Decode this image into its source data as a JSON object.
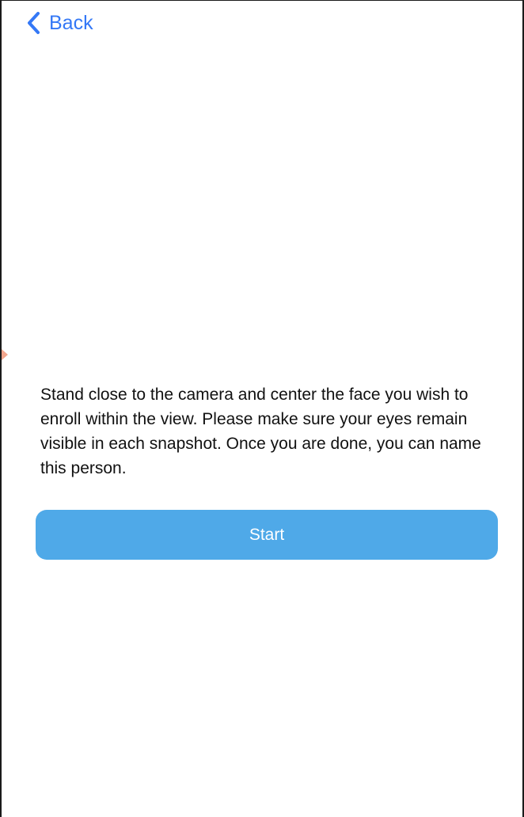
{
  "nav": {
    "back_label": "Back",
    "back_icon": "chevron-left-icon",
    "accent_color": "#3478f6"
  },
  "content": {
    "instructions": "Stand close to the camera and center the face you wish to enroll within the view. Please make sure your eyes remain visible in each snapshot. Once you are done, you can name this person."
  },
  "actions": {
    "start_label": "Start",
    "start_color": "#4fa9e8"
  }
}
